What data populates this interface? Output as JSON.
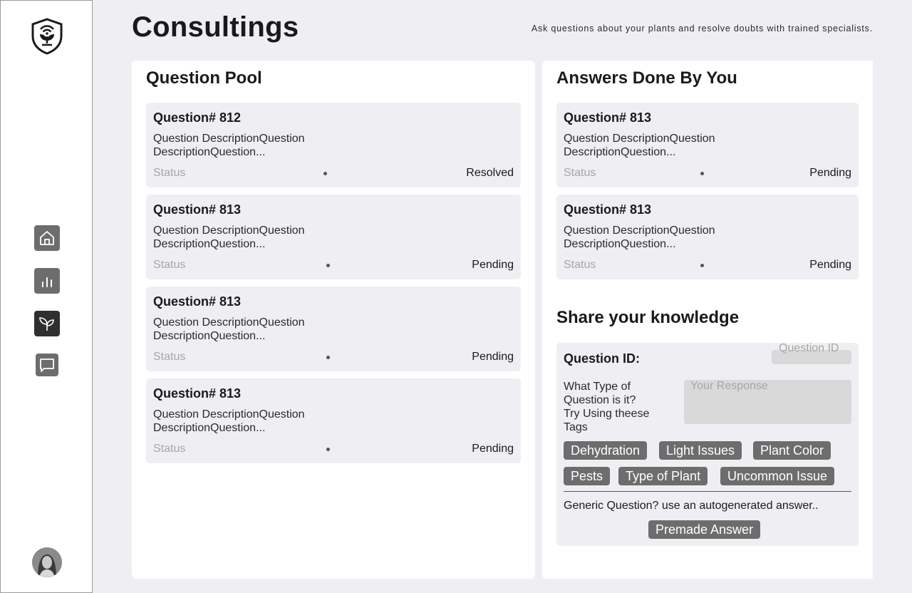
{
  "header": {
    "title": "Consultings",
    "subtitle": "Ask questions about your plants and resolve doubts with trained specialists."
  },
  "sidebar": {
    "items": [
      {
        "name": "home",
        "icon": "home-icon"
      },
      {
        "name": "stats",
        "icon": "bar-chart-icon"
      },
      {
        "name": "plants",
        "icon": "sprout-icon",
        "active": true
      },
      {
        "name": "consultings",
        "icon": "chat-icon"
      }
    ]
  },
  "question_pool": {
    "title": "Question Pool",
    "status_label": "Status",
    "items": [
      {
        "title": "Question# 812",
        "description": "Question DescriptionQuestion DescriptionQuestion...",
        "status": "Resolved"
      },
      {
        "title": "Question# 813",
        "description": "Question DescriptionQuestion DescriptionQuestion...",
        "status": "Pending"
      },
      {
        "title": "Question# 813",
        "description": "Question DescriptionQuestion DescriptionQuestion...",
        "status": "Pending"
      },
      {
        "title": "Question# 813",
        "description": "Question DescriptionQuestion DescriptionQuestion...",
        "status": "Pending"
      }
    ]
  },
  "answers": {
    "title": "Answers Done By You",
    "status_label": "Status",
    "items": [
      {
        "title": "Question# 813",
        "description": "Question DescriptionQuestion DescriptionQuestion...",
        "status": "Pending"
      },
      {
        "title": "Question# 813",
        "description": "Question DescriptionQuestion DescriptionQuestion...",
        "status": "Pending"
      }
    ]
  },
  "share": {
    "title": "Share your knowledge",
    "question_id_label": "Question ID:",
    "question_id_placeholder": "Question ID",
    "type_prompt": "What Type of Question is it?",
    "tags_hint": "Try Using theese Tags",
    "response_placeholder": "Your Response",
    "tags": [
      "Dehydration",
      "Light Issues",
      "Plant Color",
      "Pests",
      "Type of Plant",
      "Uncommon Issue"
    ],
    "generic_text": "Generic Question? use an autogenerated answer..",
    "premade_button": "Premade Answer"
  },
  "colors": {
    "background": "#efeff3",
    "panel": "#ffffff",
    "button": "#6d6d6d",
    "active_nav": "#2f2f2f",
    "input": "#d9d9d9",
    "muted_text": "#a6a6a6"
  }
}
